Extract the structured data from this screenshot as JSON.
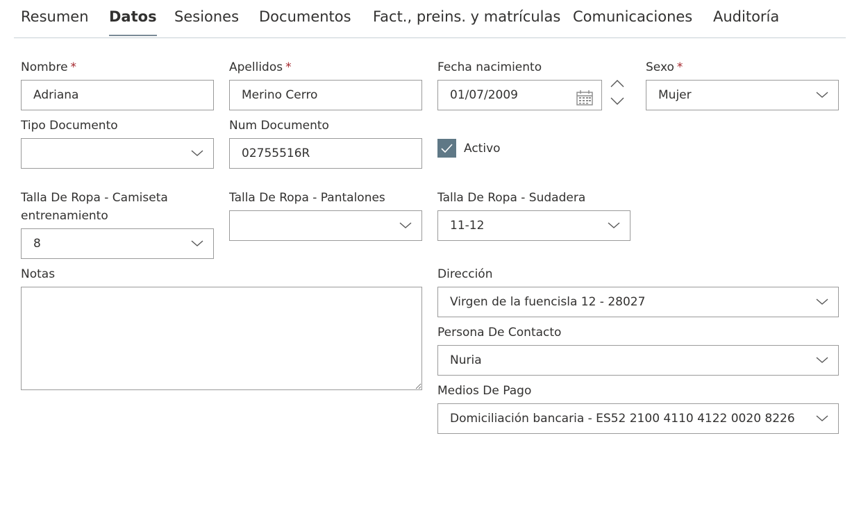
{
  "tabs": [
    {
      "label": "Resumen",
      "active": false
    },
    {
      "label": "Datos",
      "active": true
    },
    {
      "label": "Sesiones",
      "active": false
    },
    {
      "label": "Documentos",
      "active": false
    },
    {
      "label": "Fact., preins. y matrículas",
      "active": false
    },
    {
      "label": "Comunicaciones",
      "active": false
    },
    {
      "label": "Auditoría",
      "active": false
    }
  ],
  "form": {
    "nombre": {
      "label": "Nombre",
      "required_mark": "*",
      "value": "Adriana"
    },
    "apellidos": {
      "label": "Apellidos",
      "required_mark": "*",
      "value": "Merino Cerro"
    },
    "fecha_nacimiento": {
      "label": "Fecha nacimiento",
      "value": "01/07/2009"
    },
    "sexo": {
      "label": "Sexo",
      "required_mark": "*",
      "value": "Mujer"
    },
    "tipo_documento": {
      "label": "Tipo Documento",
      "value": ""
    },
    "num_documento": {
      "label": "Num Documento",
      "value": "02755516R"
    },
    "activo": {
      "label": "Activo",
      "checked": true
    },
    "talla_camiseta": {
      "label_line1": "Talla De Ropa - Camiseta",
      "label_line2": "entrenamiento",
      "value": "8"
    },
    "talla_pantalones": {
      "label": "Talla De Ropa - Pantalones",
      "value": ""
    },
    "talla_sudadera": {
      "label": "Talla De Ropa - Sudadera",
      "value": "11-12"
    },
    "notas": {
      "label": "Notas",
      "value": ""
    },
    "direccion": {
      "label": "Dirección",
      "value": "Virgen de la fuencisla 12 - 28027"
    },
    "persona_contacto": {
      "label": "Persona De Contacto",
      "value": "Nuria"
    },
    "medios_pago": {
      "label": "Medios De Pago",
      "value": "Domiciliación bancaria - ES52 2100 4110 4122 0020 8226"
    }
  },
  "colors": {
    "accent": "#5f7886",
    "required": "#a4262c",
    "border": "#9a9a9a"
  }
}
